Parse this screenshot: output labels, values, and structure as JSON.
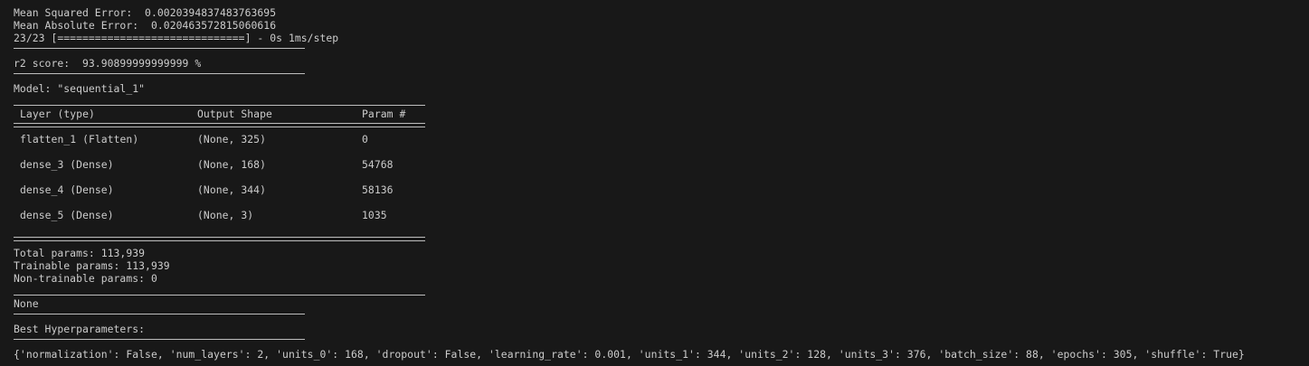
{
  "lines": {
    "mse": "Mean Squared Error:  0.0020394837483763695",
    "mae": "Mean Absolute Error:  0.020463572815060616",
    "progress": "23/23 [==============================] - 0s 1ms/step",
    "r2": "r2 score:  93.90899999999999 %",
    "model": "Model: \"sequential_1\"",
    "total_params": "Total params: 113,939",
    "trainable_params": "Trainable params: 113,939",
    "non_trainable_params": "Non-trainable params: 0",
    "none": "None",
    "best_hp_label": "Best Hyperparameters:",
    "best_hp_dict": "{'normalization': False, 'num_layers': 2, 'units_0': 168, 'dropout': False, 'learning_rate': 0.001, 'units_1': 344, 'units_2': 128, 'units_3': 376, 'batch_size': 88, 'epochs': 305, 'shuffle': True}"
  },
  "summary_table": {
    "headers": [
      "Layer (type)",
      "Output Shape",
      "Param #"
    ],
    "rows": [
      [
        "flatten_1 (Flatten)",
        "(None, 325)",
        "0"
      ],
      [
        "dense_3 (Dense)",
        "(None, 168)",
        "54768"
      ],
      [
        "dense_4 (Dense)",
        "(None, 344)",
        "58136"
      ],
      [
        "dense_5 (Dense)",
        "(None, 3)",
        "1035"
      ]
    ]
  },
  "colors": {
    "background": "#181818",
    "text": "#cccccc"
  }
}
